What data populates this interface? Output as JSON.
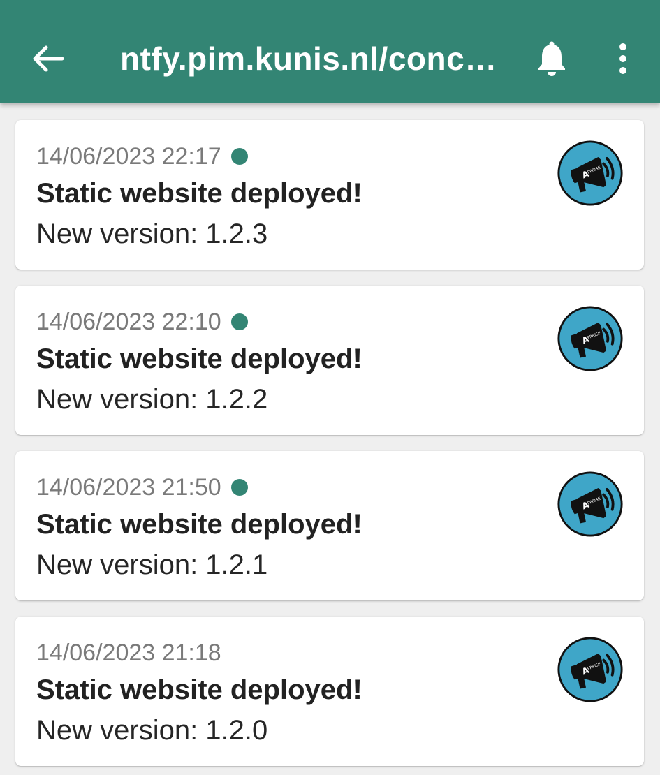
{
  "app_bar": {
    "title": "ntfy.pim.kunis.nl/conc…",
    "back_icon": "arrow-back-icon",
    "bell_icon": "bell-icon",
    "more_icon": "more-vert-icon",
    "color": "#338574"
  },
  "colors": {
    "accent": "#338574",
    "background": "#efefef",
    "card": "#ffffff",
    "date_text": "#7a7a7a"
  },
  "notifications": [
    {
      "date": "14/06/2023 22:17",
      "title": "Static website deployed!",
      "message": "New version: 1.2.3",
      "unread": true,
      "icon": "apprise-megaphone-icon"
    },
    {
      "date": "14/06/2023 22:10",
      "title": "Static website deployed!",
      "message": "New version: 1.2.2",
      "unread": true,
      "icon": "apprise-megaphone-icon"
    },
    {
      "date": "14/06/2023 21:50",
      "title": "Static website deployed!",
      "message": "New version: 1.2.1",
      "unread": true,
      "icon": "apprise-megaphone-icon"
    },
    {
      "date": "14/06/2023 21:18",
      "title": "Static website deployed!",
      "message": "New version: 1.2.0",
      "unread": false,
      "icon": "apprise-megaphone-icon"
    }
  ]
}
